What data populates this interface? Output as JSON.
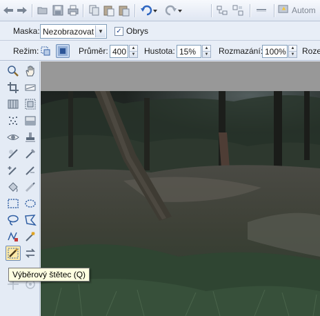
{
  "toolbar": {
    "buttons": [
      "back-icon",
      "forward-icon",
      "open-icon",
      "save-icon",
      "print-icon",
      "copy-icon",
      "paste-icon",
      "paste-special-icon",
      "undo-icon",
      "redo-icon",
      "layout-icon",
      "align-icon",
      "minimize-icon",
      "auto-icon"
    ],
    "auto_label": "Autom"
  },
  "mask": {
    "label": "Maska:",
    "selected": "Nezobrazovat",
    "outline_label": "Obrys",
    "outline_checked": true
  },
  "brush": {
    "mode_label": "Režim:",
    "diameter_label": "Průměr:",
    "diameter_value": "400",
    "density_label": "Hustota:",
    "density_value": "15%",
    "blur_label": "Rozmazání:",
    "blur_value": "100%",
    "next_label": "Roze"
  },
  "tools": [
    "zoom-icon",
    "hand-icon",
    "crop-icon",
    "straighten-icon",
    "perspective-icon",
    "resize-icon",
    "noise-icon",
    "gradient-icon",
    "red-eye-icon",
    "stamp-icon",
    "dodge-icon",
    "burn-icon",
    "sharpen-icon",
    "blur-icon",
    "fill-icon",
    "smudge-icon",
    "rect-select-icon",
    "ellipse-select-icon",
    "lasso-icon",
    "polygon-lasso-icon",
    "magnetic-lasso-icon",
    "magic-wand-icon",
    "selection-brush-icon",
    "swap-icon",
    "move-icon",
    "target-icon"
  ],
  "tooltip": "Výběrový štětec (Q)",
  "colors": {
    "accent": "#1a5fb4",
    "canvas": "#989898",
    "panel": "#e4ebf5"
  }
}
